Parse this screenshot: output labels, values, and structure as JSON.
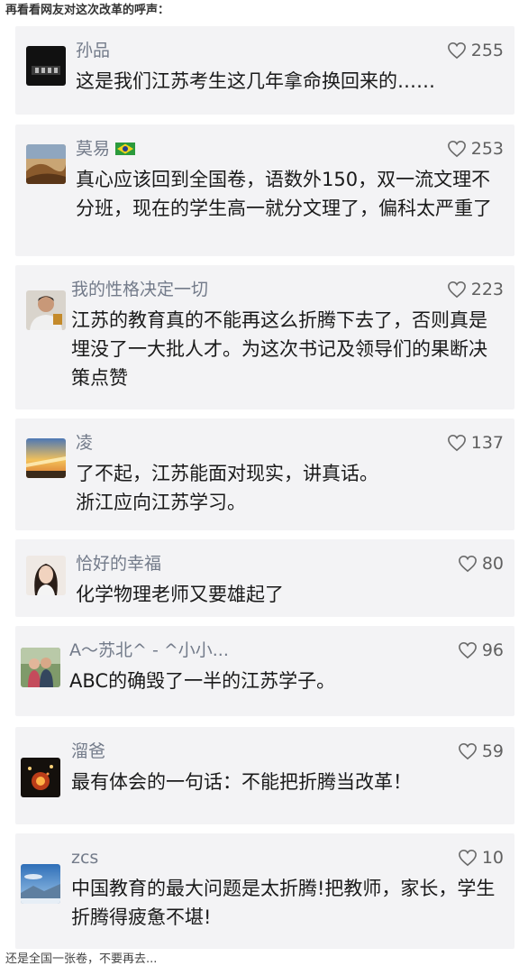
{
  "heading": "再看看网友对这次改革的呼声：",
  "colors": {
    "card_bg": "#f3f3f5",
    "name": "#737b8a",
    "text": "#1a1a1a"
  },
  "comments": [
    {
      "name": "孙品",
      "likes": "255",
      "text": "这是我们江苏考生这几年拿命换回来的……",
      "avatar_icon": "dark-poster-avatar"
    },
    {
      "name": "莫易",
      "flag_icon": "brazil-flag-icon",
      "likes": "253",
      "text": "真心应该回到全国卷，语数外150，双一流文理不分班，现在的学生高一就分文理了，偏科太严重了",
      "avatar_icon": "desert-dune-avatar"
    },
    {
      "name": "我的性格决定一切",
      "likes": "223",
      "text": "江苏的教育真的不能再这么折腾下去了，否则真是埋没了一大批人才。为这次书记及领导们的果断决策点赞",
      "avatar_icon": "person-photo-avatar"
    },
    {
      "name": "凌",
      "likes": "137",
      "text": "了不起，江苏能面对现实，讲真话。\n浙江应向江苏学习。",
      "avatar_icon": "sunset-avatar"
    },
    {
      "name": "恰好的幸福",
      "likes": "80",
      "text": "化学物理老师又要雄起了",
      "avatar_icon": "girl-portrait-avatar"
    },
    {
      "name": "A～苏北^ - ^小小...",
      "likes": "96",
      "text": "ABC的确毁了一半的江苏学子。",
      "avatar_icon": "couple-photo-avatar"
    },
    {
      "name": "溜爸",
      "likes": "59",
      "text": "最有体会的一句话：不能把折腾当改革！",
      "avatar_icon": "fireworks-avatar"
    },
    {
      "name": "zcs",
      "likes": "10",
      "text": "中国教育的最大问题是太折腾!把教师，家长，学生折腾得疲惫不堪!",
      "avatar_icon": "sky-landscape-avatar"
    }
  ],
  "cut_off_text": "还是全国一张卷，不要再去..."
}
